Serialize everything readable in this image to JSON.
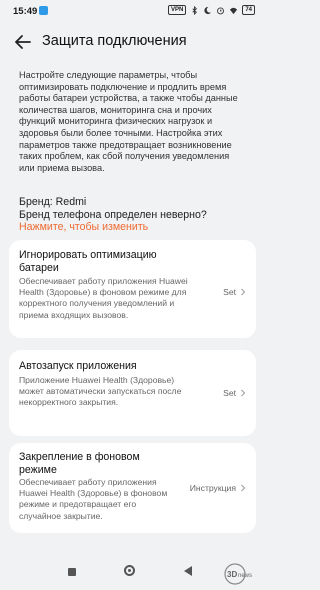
{
  "status_bar": {
    "time": "15:49",
    "vpn": "VPN",
    "battery": "74"
  },
  "header": {
    "back_icon": "arrow-left-icon",
    "title": "Защита подключения"
  },
  "description": "Настройте следующие параметры, чтобы оптимизировать подключение и продлить время работы батареи устройства, а также чтобы данные количества шагов, мониторинга сна и прочих функций мониторинга физических нагрузок и здоровья были более точными. Настройка этих параметров также предотвращает возникновение таких проблем, как сбой получения уведомления или приема вызова.",
  "brand": {
    "label": "Бренд: Redmi",
    "note": "Бренд телефона определен неверно?",
    "link": "Нажмите, чтобы изменить",
    "link_color": "#ef6a30"
  },
  "cards": [
    {
      "title": "Игнорировать оптимизацию батареи",
      "description": "Обеспечивает работу приложения Huawei Health (Здоровье) в фоновом режиме для корректного получения уведомлений и приема входящих вызовов.",
      "action": "Set"
    },
    {
      "title": "Автозапуск приложения",
      "description": "Приложение Huawei Health (Здоровье) может автоматически запускаться после некорректного закрытия.",
      "action": "Set"
    },
    {
      "title": "Закрепление в фоновом режиме",
      "description": "Обеспечивает работу приложения Huawei Health (Здоровье) в фоновом режиме и предотвращает его случайное закрытие.",
      "action": "Инструкция"
    }
  ],
  "watermark": "3DNews"
}
